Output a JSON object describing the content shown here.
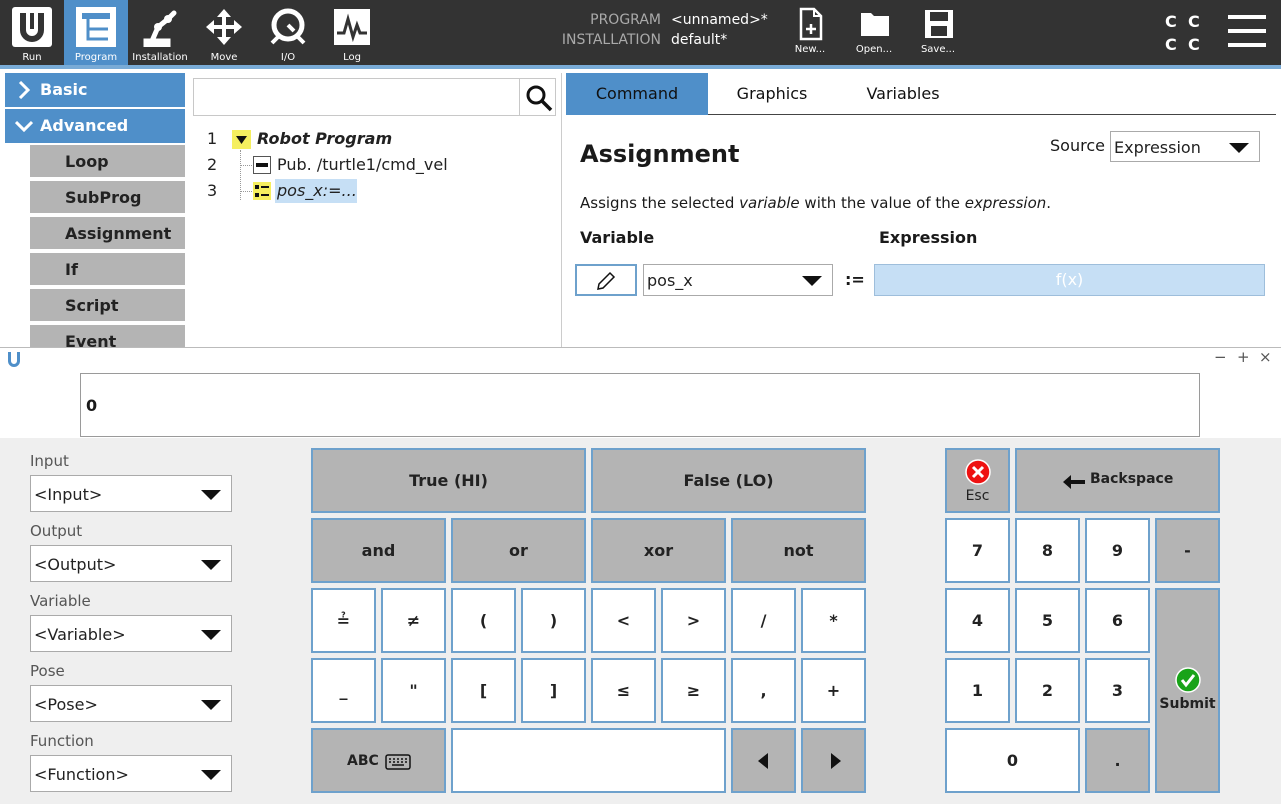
{
  "topbar": {
    "nav": [
      {
        "label": "Run",
        "icon": "ur-logo-icon"
      },
      {
        "label": "Program",
        "icon": "program-icon"
      },
      {
        "label": "Installation",
        "icon": "robot-arm-icon"
      },
      {
        "label": "Move",
        "icon": "move-arrows-icon"
      },
      {
        "label": "I/O",
        "icon": "io-icon"
      },
      {
        "label": "Log",
        "icon": "log-icon"
      }
    ],
    "program_label": "PROGRAM",
    "program_value": "<unnamed>*",
    "installation_label": "INSTALLATION",
    "installation_value": "default*",
    "file_buttons": [
      {
        "label": "New...",
        "icon": "new-file-icon"
      },
      {
        "label": "Open...",
        "icon": "open-folder-icon"
      },
      {
        "label": "Save...",
        "icon": "save-disk-icon"
      }
    ],
    "cc_letters": [
      "C",
      "C",
      "C",
      "C"
    ],
    "accent": "#4f8fc9"
  },
  "sidebar": {
    "categories": [
      {
        "label": "Basic",
        "expanded": false
      },
      {
        "label": "Advanced",
        "expanded": true
      }
    ],
    "items": [
      "Loop",
      "SubProg",
      "Assignment",
      "If",
      "Script",
      "Event"
    ]
  },
  "tree": {
    "search_placeholder": "",
    "rows": [
      {
        "num": "1",
        "label": "Robot Program"
      },
      {
        "num": "2",
        "label": "Pub. /turtle1/cmd_vel"
      },
      {
        "num": "3",
        "label": "pos_x:=..."
      }
    ]
  },
  "command": {
    "tabs": [
      "Command",
      "Graphics",
      "Variables"
    ],
    "title": "Assignment",
    "source_label": "Source",
    "source_value": "Expression",
    "desc_pre": "Assigns the selected ",
    "desc_var": "variable",
    "desc_mid": " with the value of the ",
    "desc_expr": "expression",
    "desc_end": ".",
    "variable_header": "Variable",
    "expression_header": "Expression",
    "variable_value": "pos_x",
    "assign_op": ":=",
    "expression_btn": "f(x)"
  },
  "keyboard": {
    "window_controls": [
      "−",
      "+",
      "×"
    ],
    "input_value": "0",
    "side": [
      {
        "label": "Input",
        "value": "<Input>"
      },
      {
        "label": "Output",
        "value": "<Output>"
      },
      {
        "label": "Variable",
        "value": "<Variable>"
      },
      {
        "label": "Pose",
        "value": "<Pose>"
      },
      {
        "label": "Function",
        "value": "<Function>"
      }
    ],
    "true_btn": "True (HI)",
    "false_btn": "False (LO)",
    "logic": [
      "and",
      "or",
      "xor",
      "not"
    ],
    "ops_row1": [
      "≟",
      "≠",
      "(",
      ")",
      "<",
      ">",
      "/",
      "*"
    ],
    "ops_row2": [
      "_",
      "\"",
      "[",
      "]",
      "≤",
      "≥",
      ",",
      "+"
    ],
    "abc_btn": "ABC",
    "esc_label": "Esc",
    "backspace_label": "Backspace",
    "numpad": [
      "7",
      "8",
      "9",
      "-",
      "4",
      "5",
      "6",
      "1",
      "2",
      "3",
      "0",
      "."
    ],
    "submit_label": "Submit"
  }
}
